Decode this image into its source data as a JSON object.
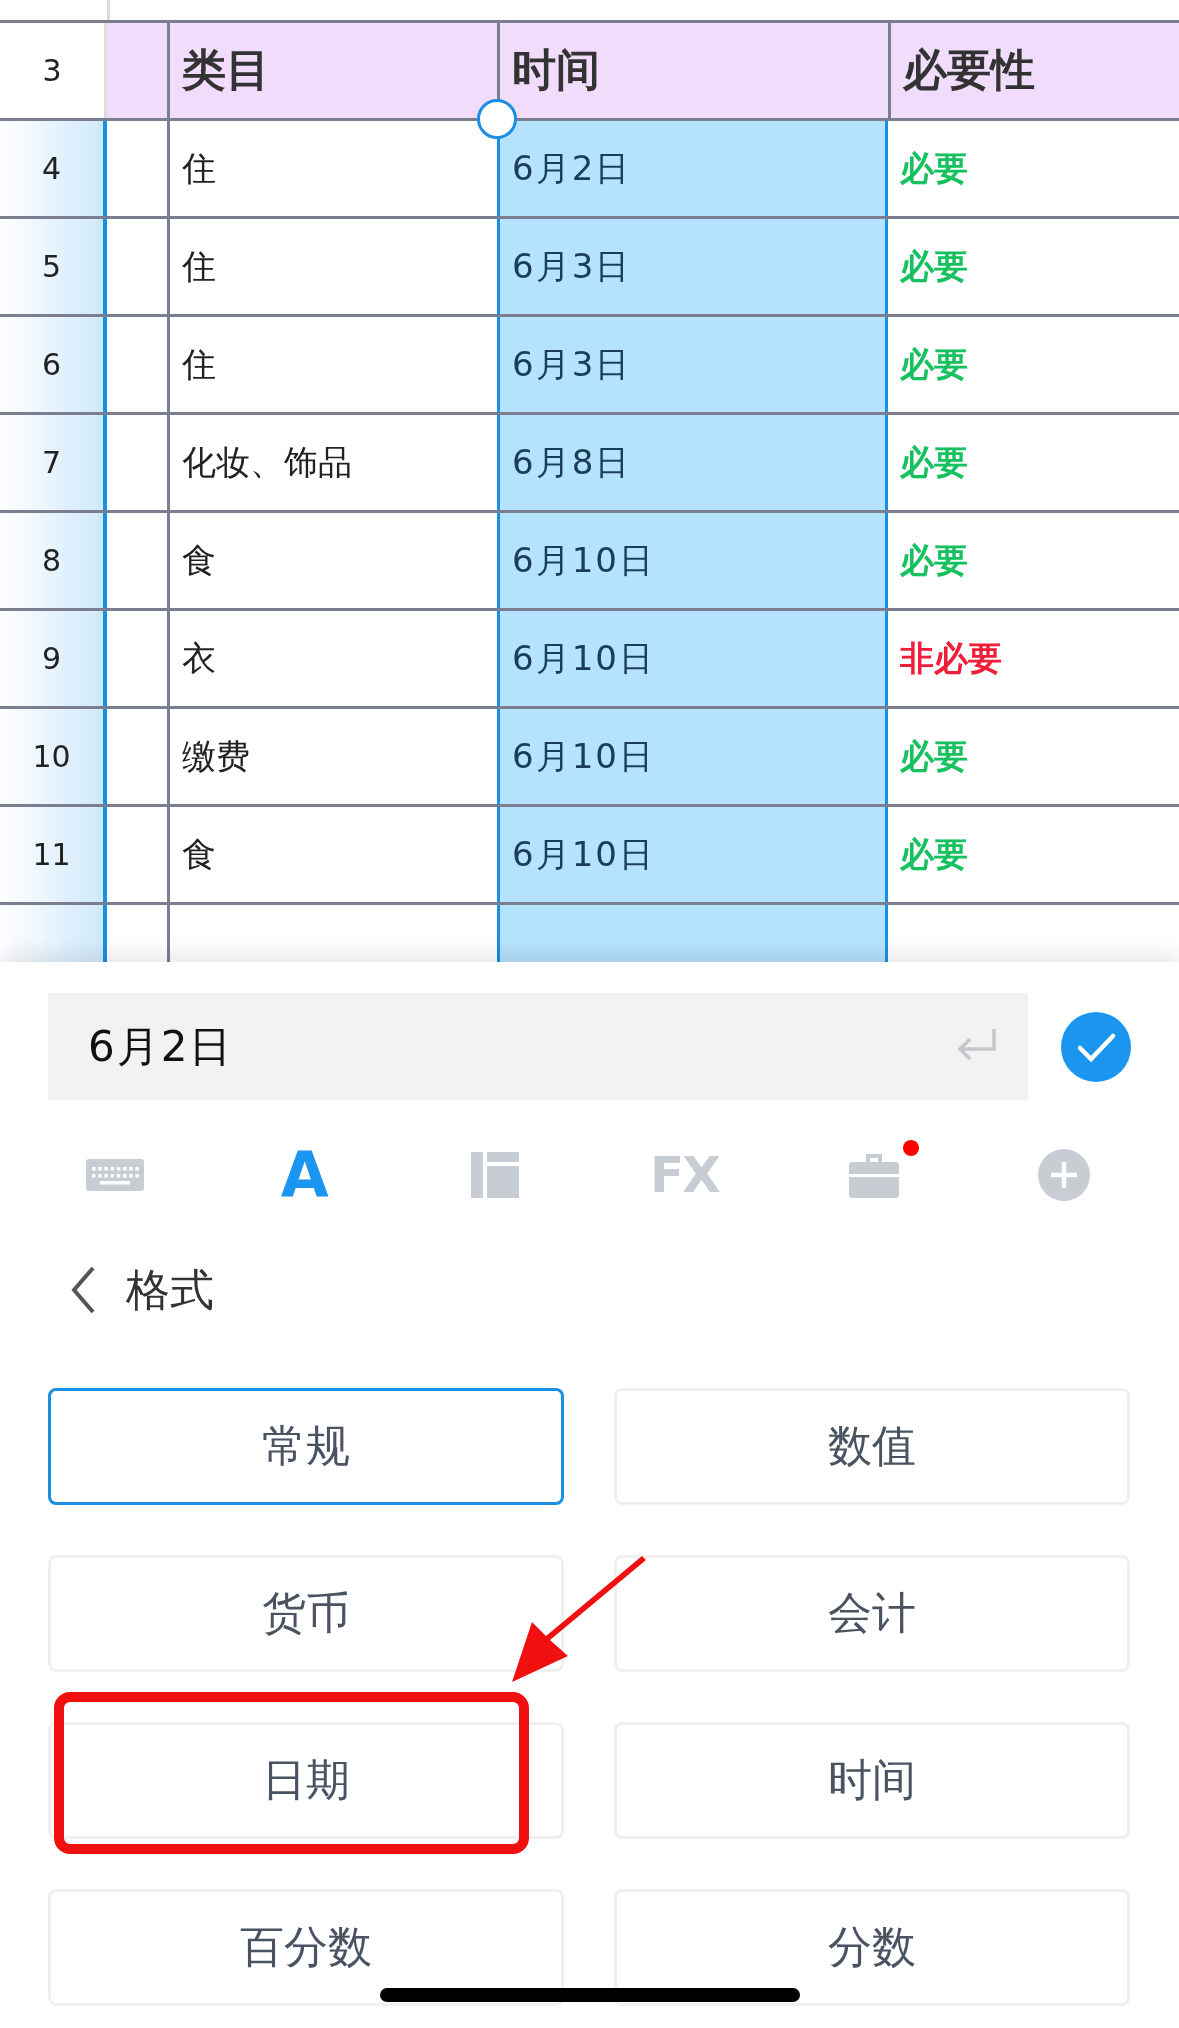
{
  "table": {
    "header": {
      "row_number": "3",
      "columns": [
        "类目",
        "时间",
        "必要性"
      ]
    },
    "rows": [
      {
        "row_number": "4",
        "category": "住",
        "date": "6月2日",
        "necessity": "必要",
        "required": true
      },
      {
        "row_number": "5",
        "category": "住",
        "date": "6月3日",
        "necessity": "必要",
        "required": true
      },
      {
        "row_number": "6",
        "category": "住",
        "date": "6月3日",
        "necessity": "必要",
        "required": true
      },
      {
        "row_number": "7",
        "category": "化妆、饰品",
        "date": "6月8日",
        "necessity": "必要",
        "required": true
      },
      {
        "row_number": "8",
        "category": "食",
        "date": "6月10日",
        "necessity": "必要",
        "required": true
      },
      {
        "row_number": "9",
        "category": "衣",
        "date": "6月10日",
        "necessity": "非必要",
        "required": false
      },
      {
        "row_number": "10",
        "category": "缴费",
        "date": "6月10日",
        "necessity": "必要",
        "required": true
      },
      {
        "row_number": "11",
        "category": "食",
        "date": "6月10日",
        "necessity": "必要",
        "required": true
      }
    ]
  },
  "formula_bar": {
    "value": "6月2日"
  },
  "toolbar": [
    {
      "kind": "keyboard",
      "selected": false
    },
    {
      "kind": "text",
      "label": "A",
      "selected": true
    },
    {
      "kind": "layout",
      "selected": false
    },
    {
      "kind": "text",
      "label": "FX",
      "selected": false
    },
    {
      "kind": "toolbox",
      "selected": false,
      "badge": true
    },
    {
      "kind": "add",
      "selected": false
    }
  ],
  "format_panel": {
    "title": "格式",
    "options": [
      {
        "label": "常规",
        "selected": true,
        "highlighted": false
      },
      {
        "label": "数值",
        "selected": false,
        "highlighted": false
      },
      {
        "label": "货币",
        "selected": false,
        "highlighted": false
      },
      {
        "label": "会计",
        "selected": false,
        "highlighted": false
      },
      {
        "label": "日期",
        "selected": false,
        "highlighted": true
      },
      {
        "label": "时间",
        "selected": false,
        "highlighted": false
      },
      {
        "label": "百分数",
        "selected": false,
        "highlighted": false
      },
      {
        "label": "分数",
        "selected": false,
        "highlighted": false
      }
    ]
  }
}
